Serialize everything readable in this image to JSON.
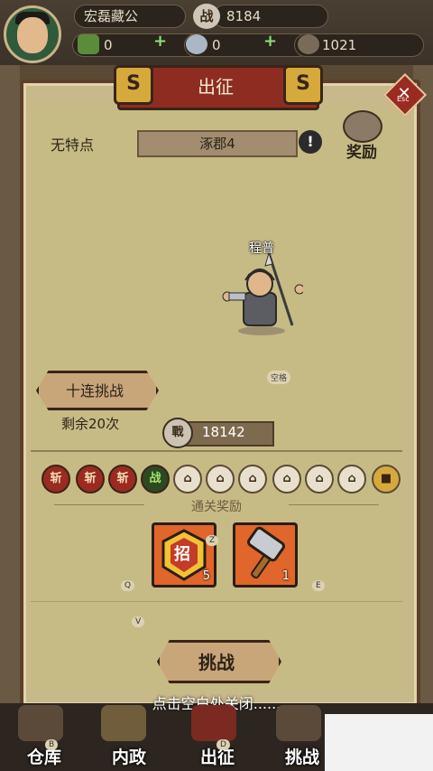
{
  "topbar": {
    "player_name": "宏磊藏公",
    "power_badge": "战",
    "power": "8184",
    "gold": "0",
    "silver": "0",
    "coins": "1021",
    "plus": "+"
  },
  "panel": {
    "title": "出征",
    "esc_label": "Esc",
    "feature": "无特点",
    "stage": "涿郡4",
    "alert": "!",
    "reward_label": "奖励",
    "hero_name": "程普",
    "space_key": "空格",
    "ten_challenge": "十连挑战",
    "remaining": "剩余20次",
    "cost_icon": "戰",
    "cost": "18142",
    "progress": [
      {
        "label": "斩",
        "state": "done"
      },
      {
        "label": "斩",
        "state": "done"
      },
      {
        "label": "斩",
        "state": "done"
      },
      {
        "label": "战",
        "state": "current"
      },
      {
        "label": "",
        "state": "locked"
      },
      {
        "label": "",
        "state": "locked"
      },
      {
        "label": "",
        "state": "locked"
      },
      {
        "label": "",
        "state": "locked"
      },
      {
        "label": "",
        "state": "locked"
      },
      {
        "label": "",
        "state": "locked"
      },
      {
        "label": "",
        "state": "chest"
      }
    ],
    "clear_reward_label": "通关奖励",
    "rewards": [
      {
        "icon": "recruit-token-icon",
        "glyph": "招",
        "count": "5",
        "key": "Z"
      },
      {
        "icon": "hammer-icon",
        "count": "1",
        "key": ""
      }
    ],
    "keys": {
      "q": "Q",
      "e": "E",
      "v": "V",
      "b": "B",
      "d": "D"
    },
    "fight_button": "挑战",
    "close_hint": "点击空白处关闭......"
  },
  "bottom_tabs": [
    {
      "label": "仓库",
      "icon": "warehouse-icon"
    },
    {
      "label": "内政",
      "icon": "politics-banner-icon"
    },
    {
      "label": "出征",
      "icon": "sword-icon"
    },
    {
      "label": "挑战",
      "icon": "helmet-icon"
    }
  ],
  "colors": {
    "panel_bg": "#c8b98b",
    "title_bar": "#8d2d22",
    "done_node": "#9b2a20",
    "current_node": "#2c4a1f"
  }
}
